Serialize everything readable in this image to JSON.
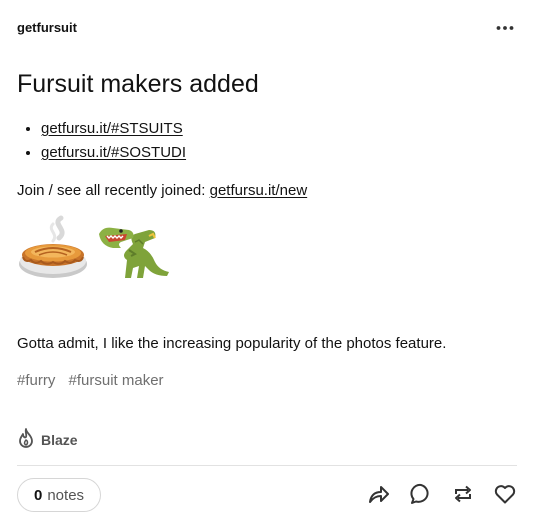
{
  "post": {
    "author": "getfursuit",
    "title": "Fursuit makers added",
    "links": [
      "getfursu.it/#STSUITS",
      "getfursu.it/#SOSTUDI"
    ],
    "join_text": "Join / see all recently joined: ",
    "join_link": "getfursu.it/new",
    "emojis": [
      "pie-emoji",
      "t-rex-emoji"
    ],
    "caption": "Gotta admit, I like the increasing popularity of the photos feature.",
    "tags": [
      "#furry",
      "#fursuit maker"
    ]
  },
  "footer": {
    "blaze_label": "Blaze",
    "notes_count": "0",
    "notes_label": "notes",
    "actions": [
      "share-icon",
      "reply-icon",
      "reblog-icon",
      "like-icon"
    ]
  },
  "colors": {
    "text": "#121212",
    "muted": "#6f6f6f",
    "divider": "#e2e2e2"
  }
}
